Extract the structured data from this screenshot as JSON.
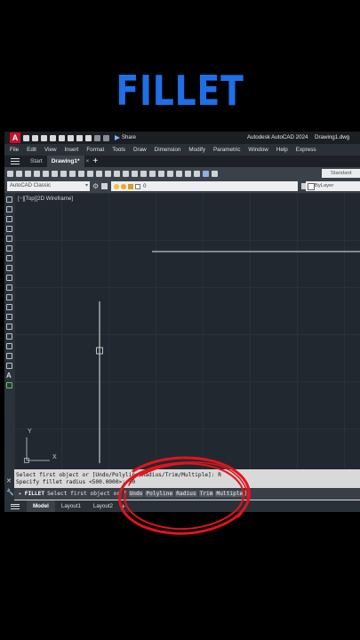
{
  "headline": "FILLET",
  "titlebar": {
    "logo_letter": "A",
    "share_label": "Share",
    "app_title": "Autodesk AutoCAD 2024",
    "file_title": "Drawing1.dwg"
  },
  "menubar": {
    "items": [
      "File",
      "Edit",
      "View",
      "Insert",
      "Format",
      "Tools",
      "Draw",
      "Dimension",
      "Modify",
      "Parametric",
      "Window",
      "Help",
      "Express"
    ]
  },
  "tabs": {
    "start": "Start",
    "drawing": "Drawing1*",
    "close_glyph": "×",
    "add_glyph": "+"
  },
  "ribbon": {
    "text_style": "Standard"
  },
  "layerbar": {
    "workspace": "AutoCAD Classic",
    "current_layer": "0",
    "linetype": "ByLayer"
  },
  "viewport": {
    "label": "[−][Top][2D Wireframe]",
    "ucs_y": "Y",
    "ucs_x": "X"
  },
  "command": {
    "history": [
      "Select first object or [Undo/Polyline/Radius/Trim/Multiple]: R",
      "Specify fillet radius <500.0000>: 50"
    ],
    "current_command": "FILLET",
    "prompt": "Select first object or [",
    "options": [
      "Undo",
      "Polyline",
      "Radius",
      "Trim",
      "Multiple"
    ],
    "prompt_end": "]:"
  },
  "statusbar": {
    "tabs": [
      "Model",
      "Layout1",
      "Layout2"
    ],
    "add_glyph": "+"
  },
  "colors": {
    "headline": "#1f6fe6",
    "annotation": "#e0141e",
    "canvas": "#212830"
  }
}
